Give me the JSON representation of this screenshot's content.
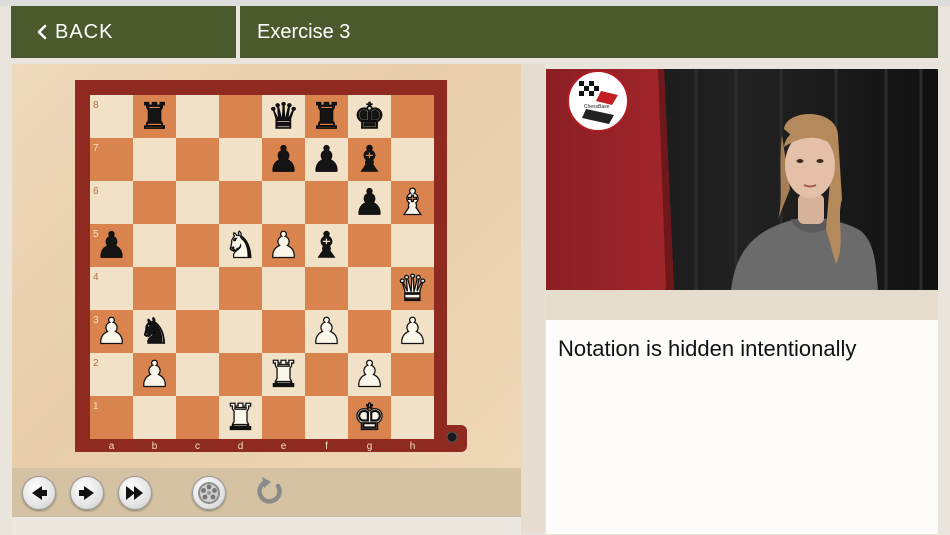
{
  "header": {
    "back_label": "BACK",
    "title": "Exercise 3"
  },
  "board": {
    "files": [
      "a",
      "b",
      "c",
      "d",
      "e",
      "f",
      "g",
      "h"
    ],
    "ranks": [
      "8",
      "7",
      "6",
      "5",
      "4",
      "3",
      "2",
      "1"
    ],
    "colors": {
      "light": "#f1e1c6",
      "dark": "#d9844e",
      "frame": "#8e2a1f"
    },
    "pieces": [
      {
        "sq": "b8",
        "piece": "r"
      },
      {
        "sq": "e8",
        "piece": "q"
      },
      {
        "sq": "f8",
        "piece": "r"
      },
      {
        "sq": "g8",
        "piece": "k"
      },
      {
        "sq": "e7",
        "piece": "p"
      },
      {
        "sq": "f7",
        "piece": "p"
      },
      {
        "sq": "g7",
        "piece": "b"
      },
      {
        "sq": "g6",
        "piece": "p"
      },
      {
        "sq": "h6",
        "piece": "B"
      },
      {
        "sq": "a5",
        "piece": "p"
      },
      {
        "sq": "d5",
        "piece": "N"
      },
      {
        "sq": "e5",
        "piece": "P"
      },
      {
        "sq": "f5",
        "piece": "b"
      },
      {
        "sq": "h4",
        "piece": "Q"
      },
      {
        "sq": "a3",
        "piece": "P"
      },
      {
        "sq": "b3",
        "piece": "n"
      },
      {
        "sq": "f3",
        "piece": "P"
      },
      {
        "sq": "h3",
        "piece": "P"
      },
      {
        "sq": "b2",
        "piece": "P"
      },
      {
        "sq": "e2",
        "piece": "R"
      },
      {
        "sq": "g2",
        "piece": "P"
      },
      {
        "sq": "d1",
        "piece": "R"
      },
      {
        "sq": "g1",
        "piece": "K"
      }
    ]
  },
  "controls": [
    {
      "name": "prev-move-button",
      "icon": "arrow-left-icon"
    },
    {
      "name": "next-move-button",
      "icon": "arrow-right-icon"
    },
    {
      "name": "fast-forward-button",
      "icon": "fast-forward-icon"
    },
    {
      "name": "settings-wheel-button",
      "icon": "wheel-icon"
    },
    {
      "name": "restart-button",
      "icon": "rotate-icon"
    }
  ],
  "video": {
    "logo_text": "ChessBase"
  },
  "notation": {
    "text": "Notation is hidden intentionally"
  }
}
